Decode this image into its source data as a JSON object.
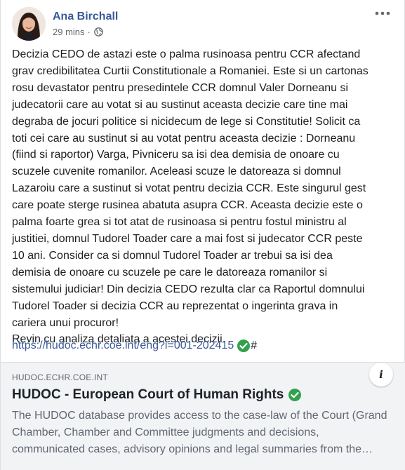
{
  "post": {
    "author": "Ana Birchall",
    "time": "29 mins",
    "separator": "·",
    "privacy_icon": "globe-icon",
    "more_icon": "more-options-icon",
    "body_lines": [
      "Decizia CEDO de astazi este o palma rusinoasa pentru CCR afectand",
      "grav credibilitatea Curtii Constitutionale a Romaniei. Este si un cartonas",
      "rosu devastator pentru presedintele CCR domnul Valer Dorneanu si",
      "judecatorii care au votat si au sustinut aceasta decizie care tine mai",
      "degraba de jocuri politice si nicidecum de lege si Constitutie! Solicit ca",
      "toti cei care au sustinut si au votat pentru aceasta decizie : Dorneanu",
      "(fiind si raportor) Varga, Pivniceru sa isi dea demisia de onoare cu",
      "scuzele cuvenite romanilor. Aceleasi scuze le datoreaza si domnul",
      "Lazaroiu care a sustinut si votat pentru decizia CCR. Este singurul gest",
      "care poate sterge rusinea abatuta asupra CCR. Aceasta decizie este o",
      "palma foarte grea si tot atat de rusinoasa si pentru fostul ministru al",
      "justitiei, domnul Tudorel Toader care a mai fost si judecator CCR peste",
      "10 ani. Consider ca si domnul Tudorel Toader ar trebui sa isi dea",
      "demisia de onoare cu scuzele pe care le datoreaza romanilor si",
      "sistemului judiciar! Din decizia CEDO rezulta clar ca Raportul domnului",
      "Tudorel Toader si decizia CCR au reprezentat o ingerinta grava in",
      "cariera unui procuror!",
      "Revin cu analiza detaliata a acestei decizii."
    ],
    "link_text": "https://hudoc.echr.coe.int/eng?i=001-202415",
    "link_suffix": "#"
  },
  "preview": {
    "domain": "HUDOC.ECHR.COE.INT",
    "title": "HUDOC - European Court of Human Rights",
    "description": "The HUDOC database provides access to the case-law of the Court (Grand Chamber, Chamber and Committee judgments and decisions, communicated cases, advisory opinions and legal summaries from the…",
    "info_label": "i"
  },
  "colors": {
    "author": "#385898",
    "link": "#385898",
    "check_green": "#31a24c",
    "meta": "#606770",
    "preview_bg": "#f2f3f5"
  }
}
